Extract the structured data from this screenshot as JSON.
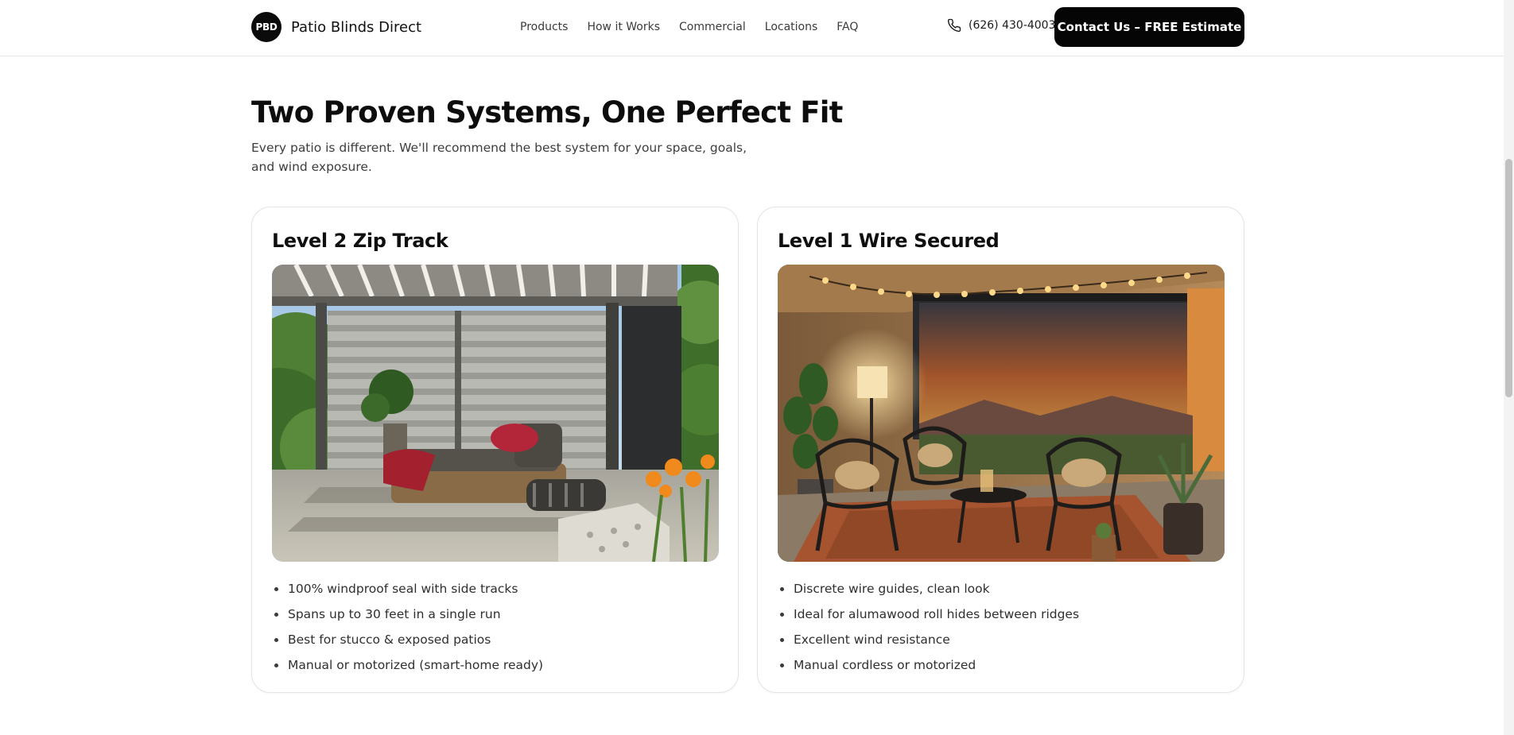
{
  "header": {
    "logo_text": "PBD",
    "brand_name": "Patio Blinds Direct",
    "nav": [
      "Products",
      "How it Works",
      "Commercial",
      "Locations",
      "FAQ"
    ],
    "phone": "(626) 430-4003",
    "cta_label": "Contact Us – FREE Estimate"
  },
  "section": {
    "title": "Two Proven Systems, One Perfect Fit",
    "subtitle": "Every patio is different. We'll recommend the best system for your space, goals, and wind exposure."
  },
  "cards": [
    {
      "title": "Level 2 Zip Track",
      "features": [
        "100% windproof seal with side tracks",
        "Spans up to 30 feet in a single run",
        "Best for stucco & exposed patios",
        "Manual or motorized (smart-home ready)"
      ]
    },
    {
      "title": "Level 1 Wire Secured",
      "features": [
        "Discrete wire guides, clean look",
        "Ideal for alumawood roll hides between ridges",
        "Excellent wind resistance",
        "Manual cordless or motorized"
      ]
    }
  ],
  "colors": {
    "cta_background": "#050505",
    "text_primary": "#111111",
    "card_border": "#e4e4e4"
  },
  "icons": {
    "phone": "phone-icon"
  }
}
